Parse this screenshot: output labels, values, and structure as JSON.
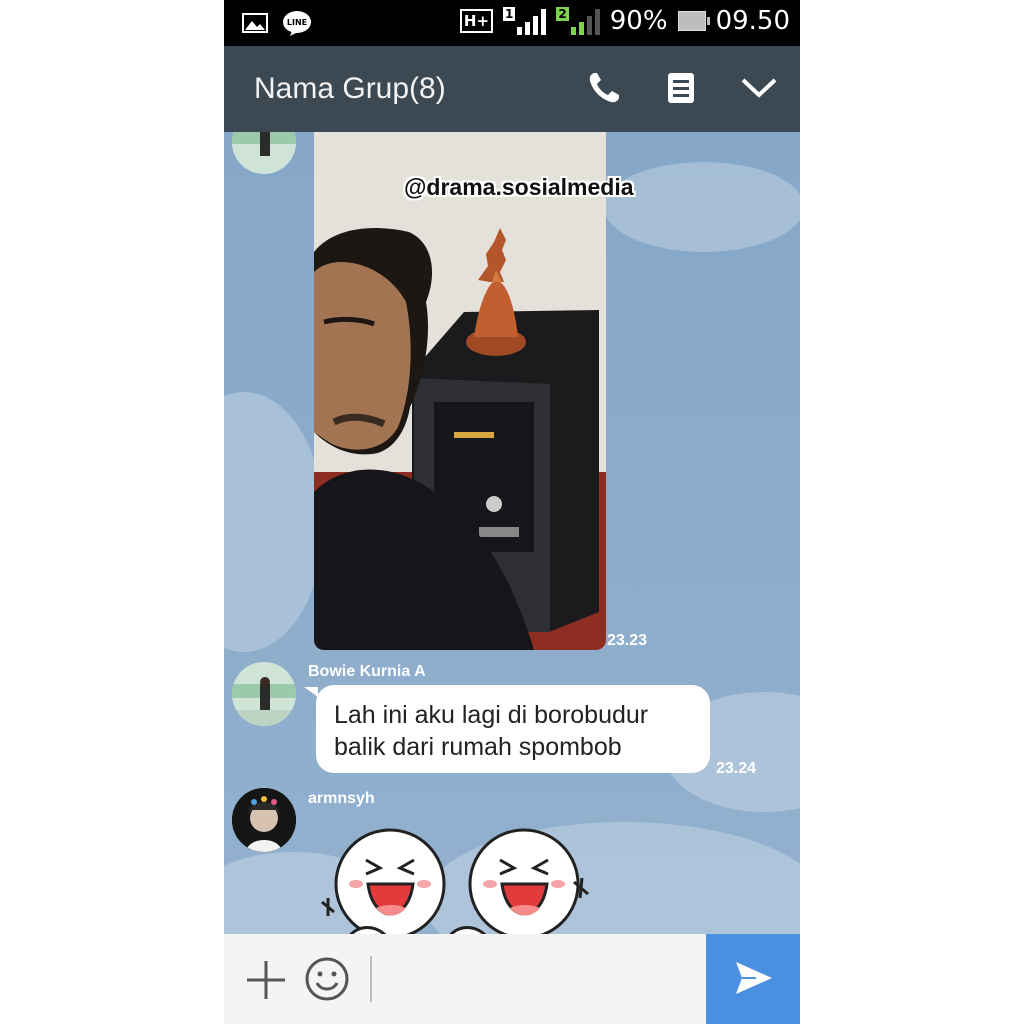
{
  "status_bar": {
    "network_type": "H+",
    "sim1_label": "1",
    "sim2_label": "2",
    "battery": "90%",
    "time": "09.50",
    "notification_icons": [
      "gallery-icon",
      "line-app-icon"
    ]
  },
  "header": {
    "title": "Nama Grup(8)",
    "icons": [
      "phone-icon",
      "notes-icon",
      "chevron-down-icon"
    ]
  },
  "messages": {
    "photo": {
      "watermark": "@drama.sosialmedia",
      "time": "23.23"
    },
    "text_message": {
      "sender": "Bowie Kurnia A",
      "lines": [
        "Lah ini aku lagi di borobudur",
        "balik dari rumah spombob"
      ],
      "time": "23.24"
    },
    "sticker_message": {
      "sender": "armnsyh",
      "sticker": "two-laughing-characters"
    }
  },
  "input_bar": {
    "icons": [
      "plus-icon",
      "emoji-icon",
      "send-icon"
    ],
    "text_value": ""
  },
  "colors": {
    "header": "#3c4852",
    "chat_background": "#8aa9c9",
    "send_button": "#4b8fe0"
  }
}
